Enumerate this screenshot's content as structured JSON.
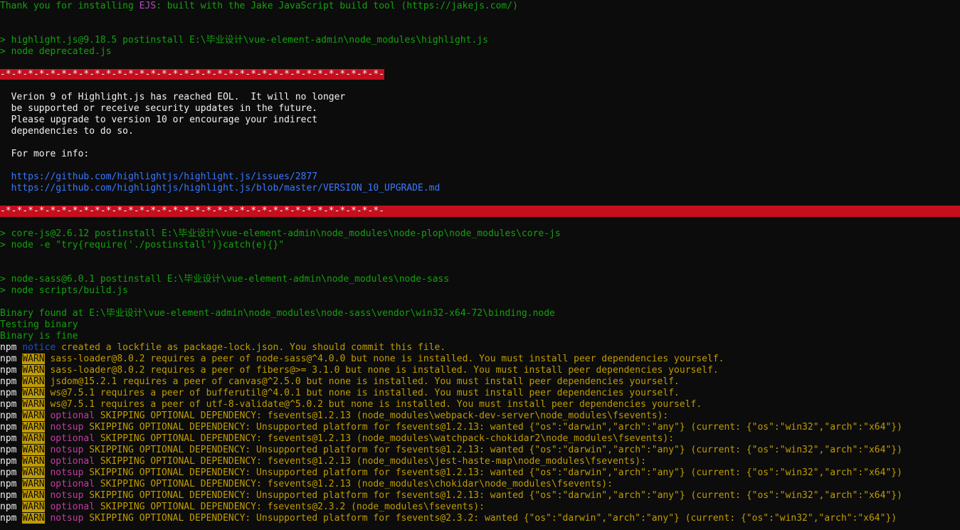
{
  "terminal": {
    "colors": {
      "background": "#0c0c0c",
      "gray": "#cccccc",
      "green": "#13a10e",
      "magenta": "#b548c6",
      "blue": "#3b78ff",
      "yellow": "#c19c00",
      "red": "#c50f1f"
    },
    "lines": [
      {
        "segs": [
          {
            "t": "Thank you for installing ",
            "c": "green"
          },
          {
            "t": "EJS",
            "c": "magenta"
          },
          {
            "t": ": built with the Jake JavaScript build tool (https://jakejs.com/)",
            "c": "green"
          }
        ]
      },
      {
        "segs": []
      },
      {
        "segs": []
      },
      {
        "segs": [
          {
            "t": "> highlight.js@9.18.5 postinstall E:\\毕业设计\\vue-element-admin\\node_modules\\highlight.js",
            "c": "green"
          }
        ]
      },
      {
        "segs": [
          {
            "t": "> node deprecated.js",
            "c": "green"
          }
        ]
      },
      {
        "segs": []
      },
      {
        "segs": [
          {
            "t": "-*-*-*-*-*-*-*-*-*-*-*-*-*-*-*-*-*-*-*-*-*-*-*-*-*-*-*-*-*-*-*-*-*-*-",
            "c": "bg-red"
          }
        ]
      },
      {
        "segs": []
      },
      {
        "segs": [
          {
            "t": "  Verion 9 of Highlight.js has reached EOL.  It will no longer",
            "c": "white"
          }
        ]
      },
      {
        "segs": [
          {
            "t": "  be supported or receive security updates in the future.",
            "c": "white"
          }
        ]
      },
      {
        "segs": [
          {
            "t": "  Please upgrade to version 10 or encourage your indirect",
            "c": "white"
          }
        ]
      },
      {
        "segs": [
          {
            "t": "  dependencies to do so.",
            "c": "white"
          }
        ]
      },
      {
        "segs": []
      },
      {
        "segs": [
          {
            "t": "  For more info:",
            "c": "white"
          }
        ]
      },
      {
        "segs": []
      },
      {
        "segs": [
          {
            "t": "  https://github.com/highlightjs/highlight.js/issues/2877",
            "c": "blue"
          }
        ]
      },
      {
        "segs": [
          {
            "t": "  https://github.com/highlightjs/highlight.js/blob/master/VERSION_10_UPGRADE.md",
            "c": "blue"
          }
        ]
      },
      {
        "segs": []
      },
      {
        "full": true,
        "segs": [
          {
            "t": "-*-*-*-*-*-*-*-*-*-*-*-*-*-*-*-*-*-*-*-*-*-*-*-*-*-*-*-*-*-*-*-*-*-*-",
            "c": "bg-red"
          }
        ]
      },
      {
        "segs": []
      },
      {
        "segs": [
          {
            "t": "> core-js@2.6.12 postinstall E:\\毕业设计\\vue-element-admin\\node_modules\\node-plop\\node_modules\\core-js",
            "c": "green"
          }
        ]
      },
      {
        "segs": [
          {
            "t": "> node -e \"try{require('./postinstall')}catch(e){}\"",
            "c": "green"
          }
        ]
      },
      {
        "segs": []
      },
      {
        "segs": []
      },
      {
        "segs": [
          {
            "t": "> node-sass@6.0.1 postinstall E:\\毕业设计\\vue-element-admin\\node_modules\\node-sass",
            "c": "green"
          }
        ]
      },
      {
        "segs": [
          {
            "t": "> node scripts/build.js",
            "c": "green"
          }
        ]
      },
      {
        "segs": []
      },
      {
        "segs": [
          {
            "t": "Binary found at E:\\毕业设计\\vue-element-admin\\node_modules\\node-sass\\vendor\\win32-x64-72\\binding.node",
            "c": "green"
          }
        ]
      },
      {
        "segs": [
          {
            "t": "Testing binary",
            "c": "green"
          }
        ]
      },
      {
        "segs": [
          {
            "t": "Binary is fine",
            "c": "green"
          }
        ]
      },
      {
        "segs": [
          {
            "t": "npm ",
            "c": "white"
          },
          {
            "t": "notice",
            "c": "darkblue"
          },
          {
            "t": " created a lockfile as package-lock.json. You should commit this file.",
            "c": "yellow"
          }
        ]
      },
      {
        "segs": [
          {
            "t": "npm ",
            "c": "white"
          },
          {
            "t": "WARN",
            "c": "bg-yellow"
          },
          {
            "t": " sass-loader@8.0.2 requires a peer of node-sass@^4.0.0 but none is installed. You must install peer dependencies yourself.",
            "c": "yellow"
          }
        ]
      },
      {
        "segs": [
          {
            "t": "npm ",
            "c": "white"
          },
          {
            "t": "WARN",
            "c": "bg-yellow"
          },
          {
            "t": " sass-loader@8.0.2 requires a peer of fibers@>= 3.1.0 but none is installed. You must install peer dependencies yourself.",
            "c": "yellow"
          }
        ]
      },
      {
        "segs": [
          {
            "t": "npm ",
            "c": "white"
          },
          {
            "t": "WARN",
            "c": "bg-yellow"
          },
          {
            "t": " jsdom@15.2.1 requires a peer of canvas@^2.5.0 but none is installed. You must install peer dependencies yourself.",
            "c": "yellow"
          }
        ]
      },
      {
        "segs": [
          {
            "t": "npm ",
            "c": "white"
          },
          {
            "t": "WARN",
            "c": "bg-yellow"
          },
          {
            "t": " ws@7.5.1 requires a peer of bufferutil@^4.0.1 but none is installed. You must install peer dependencies yourself.",
            "c": "yellow"
          }
        ]
      },
      {
        "segs": [
          {
            "t": "npm ",
            "c": "white"
          },
          {
            "t": "WARN",
            "c": "bg-yellow"
          },
          {
            "t": " ws@7.5.1 requires a peer of utf-8-validate@^5.0.2 but none is installed. You must install peer dependencies yourself.",
            "c": "yellow"
          }
        ]
      },
      {
        "segs": [
          {
            "t": "npm ",
            "c": "white"
          },
          {
            "t": "WARN",
            "c": "bg-yellow"
          },
          {
            "t": " ",
            "c": "yellow"
          },
          {
            "t": "optional",
            "c": "pink"
          },
          {
            "t": " SKIPPING OPTIONAL DEPENDENCY: fsevents@1.2.13 (node_modules\\webpack-dev-server\\node_modules\\fsevents):",
            "c": "yellow"
          }
        ]
      },
      {
        "segs": [
          {
            "t": "npm ",
            "c": "white"
          },
          {
            "t": "WARN",
            "c": "bg-yellow"
          },
          {
            "t": " ",
            "c": "yellow"
          },
          {
            "t": "notsup",
            "c": "pink"
          },
          {
            "t": " SKIPPING OPTIONAL DEPENDENCY: Unsupported platform for fsevents@1.2.13: wanted {\"os\":\"darwin\",\"arch\":\"any\"} (current: {\"os\":\"win32\",\"arch\":\"x64\"})",
            "c": "yellow"
          }
        ]
      },
      {
        "segs": [
          {
            "t": "npm ",
            "c": "white"
          },
          {
            "t": "WARN",
            "c": "bg-yellow"
          },
          {
            "t": " ",
            "c": "yellow"
          },
          {
            "t": "optional",
            "c": "pink"
          },
          {
            "t": " SKIPPING OPTIONAL DEPENDENCY: fsevents@1.2.13 (node_modules\\watchpack-chokidar2\\node_modules\\fsevents):",
            "c": "yellow"
          }
        ]
      },
      {
        "segs": [
          {
            "t": "npm ",
            "c": "white"
          },
          {
            "t": "WARN",
            "c": "bg-yellow"
          },
          {
            "t": " ",
            "c": "yellow"
          },
          {
            "t": "notsup",
            "c": "pink"
          },
          {
            "t": " SKIPPING OPTIONAL DEPENDENCY: Unsupported platform for fsevents@1.2.13: wanted {\"os\":\"darwin\",\"arch\":\"any\"} (current: {\"os\":\"win32\",\"arch\":\"x64\"})",
            "c": "yellow"
          }
        ]
      },
      {
        "segs": [
          {
            "t": "npm ",
            "c": "white"
          },
          {
            "t": "WARN",
            "c": "bg-yellow"
          },
          {
            "t": " ",
            "c": "yellow"
          },
          {
            "t": "optional",
            "c": "pink"
          },
          {
            "t": " SKIPPING OPTIONAL DEPENDENCY: fsevents@1.2.13 (node_modules\\jest-haste-map\\node_modules\\fsevents):",
            "c": "yellow"
          }
        ]
      },
      {
        "segs": [
          {
            "t": "npm ",
            "c": "white"
          },
          {
            "t": "WARN",
            "c": "bg-yellow"
          },
          {
            "t": " ",
            "c": "yellow"
          },
          {
            "t": "notsup",
            "c": "pink"
          },
          {
            "t": " SKIPPING OPTIONAL DEPENDENCY: Unsupported platform for fsevents@1.2.13: wanted {\"os\":\"darwin\",\"arch\":\"any\"} (current: {\"os\":\"win32\",\"arch\":\"x64\"})",
            "c": "yellow"
          }
        ]
      },
      {
        "segs": [
          {
            "t": "npm ",
            "c": "white"
          },
          {
            "t": "WARN",
            "c": "bg-yellow"
          },
          {
            "t": " ",
            "c": "yellow"
          },
          {
            "t": "optional",
            "c": "pink"
          },
          {
            "t": " SKIPPING OPTIONAL DEPENDENCY: fsevents@1.2.13 (node_modules\\chokidar\\node_modules\\fsevents):",
            "c": "yellow"
          }
        ]
      },
      {
        "segs": [
          {
            "t": "npm ",
            "c": "white"
          },
          {
            "t": "WARN",
            "c": "bg-yellow"
          },
          {
            "t": " ",
            "c": "yellow"
          },
          {
            "t": "notsup",
            "c": "pink"
          },
          {
            "t": " SKIPPING OPTIONAL DEPENDENCY: Unsupported platform for fsevents@1.2.13: wanted {\"os\":\"darwin\",\"arch\":\"any\"} (current: {\"os\":\"win32\",\"arch\":\"x64\"})",
            "c": "yellow"
          }
        ]
      },
      {
        "segs": [
          {
            "t": "npm ",
            "c": "white"
          },
          {
            "t": "WARN",
            "c": "bg-yellow"
          },
          {
            "t": " ",
            "c": "yellow"
          },
          {
            "t": "optional",
            "c": "pink"
          },
          {
            "t": " SKIPPING OPTIONAL DEPENDENCY: fsevents@2.3.2 (node_modules\\fsevents):",
            "c": "yellow"
          }
        ]
      },
      {
        "segs": [
          {
            "t": "npm ",
            "c": "white"
          },
          {
            "t": "WARN",
            "c": "bg-yellow"
          },
          {
            "t": " ",
            "c": "yellow"
          },
          {
            "t": "notsup",
            "c": "pink"
          },
          {
            "t": " SKIPPING OPTIONAL DEPENDENCY: Unsupported platform for fsevents@2.3.2: wanted {\"os\":\"darwin\",\"arch\":\"any\"} (current: {\"os\":\"win32\",\"arch\":\"x64\"})",
            "c": "yellow"
          }
        ]
      }
    ]
  }
}
